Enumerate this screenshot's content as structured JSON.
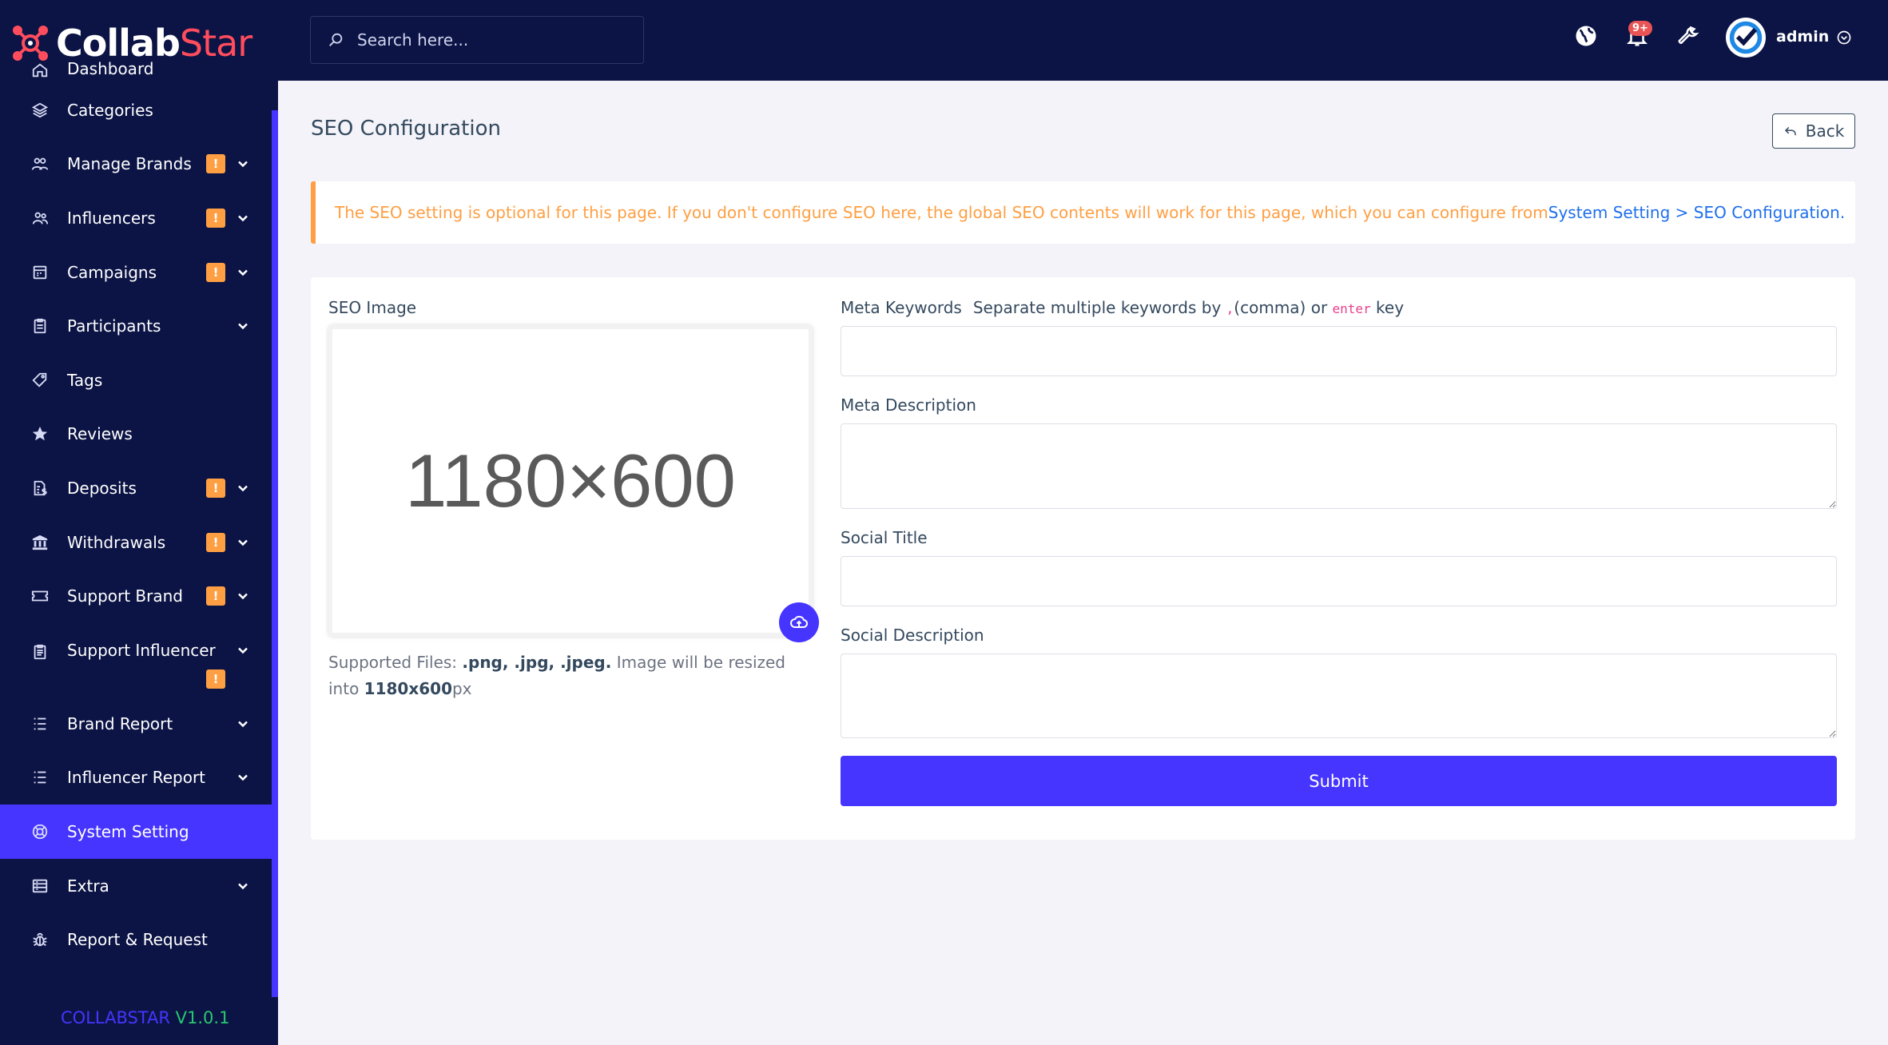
{
  "brand": {
    "name_part1": "Collab",
    "name_part2": "Star"
  },
  "search": {
    "placeholder": "Search here..."
  },
  "topbar": {
    "notification_count": "9+",
    "user_name": "admin"
  },
  "sidebar": {
    "items": [
      {
        "label": "Dashboard",
        "icon": "home-icon"
      },
      {
        "label": "Categories",
        "icon": "layers-icon"
      },
      {
        "label": "Manage Brands",
        "icon": "users-cog-icon",
        "badge": "!",
        "dropdown": true
      },
      {
        "label": "Influencers",
        "icon": "users-icon",
        "badge": "!",
        "dropdown": true
      },
      {
        "label": "Campaigns",
        "icon": "calendar-icon",
        "badge": "!",
        "dropdown": true
      },
      {
        "label": "Participants",
        "icon": "clipboard-icon",
        "dropdown": true
      },
      {
        "label": "Tags",
        "icon": "tag-icon"
      },
      {
        "label": "Reviews",
        "icon": "star-icon"
      },
      {
        "label": "Deposits",
        "icon": "file-dollar-icon",
        "badge": "!",
        "dropdown": true
      },
      {
        "label": "Withdrawals",
        "icon": "bank-icon",
        "badge": "!",
        "dropdown": true
      },
      {
        "label": "Support Brand",
        "icon": "ticket-icon",
        "badge": "!",
        "dropdown": true
      },
      {
        "label": "Support Influencer",
        "icon": "clipboard-list-icon",
        "badge": "!",
        "dropdown": true
      },
      {
        "label": "Brand Report",
        "icon": "list-icon",
        "dropdown": true
      },
      {
        "label": "Influencer Report",
        "icon": "list-icon",
        "dropdown": true
      },
      {
        "label": "System Setting",
        "icon": "life-ring-icon",
        "active": true
      },
      {
        "label": "Extra",
        "icon": "server-icon",
        "dropdown": true
      },
      {
        "label": "Report & Request",
        "icon": "bug-icon"
      }
    ],
    "version_name": "COLLABSTAR",
    "version_number": "V1.0.1"
  },
  "page": {
    "title": "SEO Configuration",
    "back_label": "Back",
    "alert_text": "The SEO setting is optional for this page. If you don't configure SEO here, the global SEO contents will work for this page, which you can configure from ",
    "alert_link": "System Setting > SEO Configuration."
  },
  "form": {
    "seo_image_label": "SEO Image",
    "image_placeholder_text": "1180×600",
    "supported_prefix": "Supported Files: ",
    "supported_types": ".png, .jpg, .jpeg.",
    "supported_middle": " Image will be resized into ",
    "supported_size": "1180x600",
    "supported_unit": "px",
    "meta_keywords_label": "Meta Keywords",
    "meta_keywords_hint_1": "Separate multiple keywords by ",
    "meta_keywords_hint_code1": ",",
    "meta_keywords_hint_2": "(comma) or ",
    "meta_keywords_hint_code2": "enter",
    "meta_keywords_hint_3": " key",
    "meta_keywords_value": "",
    "meta_description_label": "Meta Description",
    "meta_description_value": "",
    "social_title_label": "Social Title",
    "social_title_value": "",
    "social_description_label": "Social Description",
    "social_description_value": "",
    "submit_label": "Submit"
  },
  "colors": {
    "primary": "#4634ff",
    "sidebar_bg": "#0c1445",
    "warning": "#ff9f43",
    "success": "#28c76f",
    "danger": "#ea5455",
    "brand_red": "#ff4d5e"
  }
}
